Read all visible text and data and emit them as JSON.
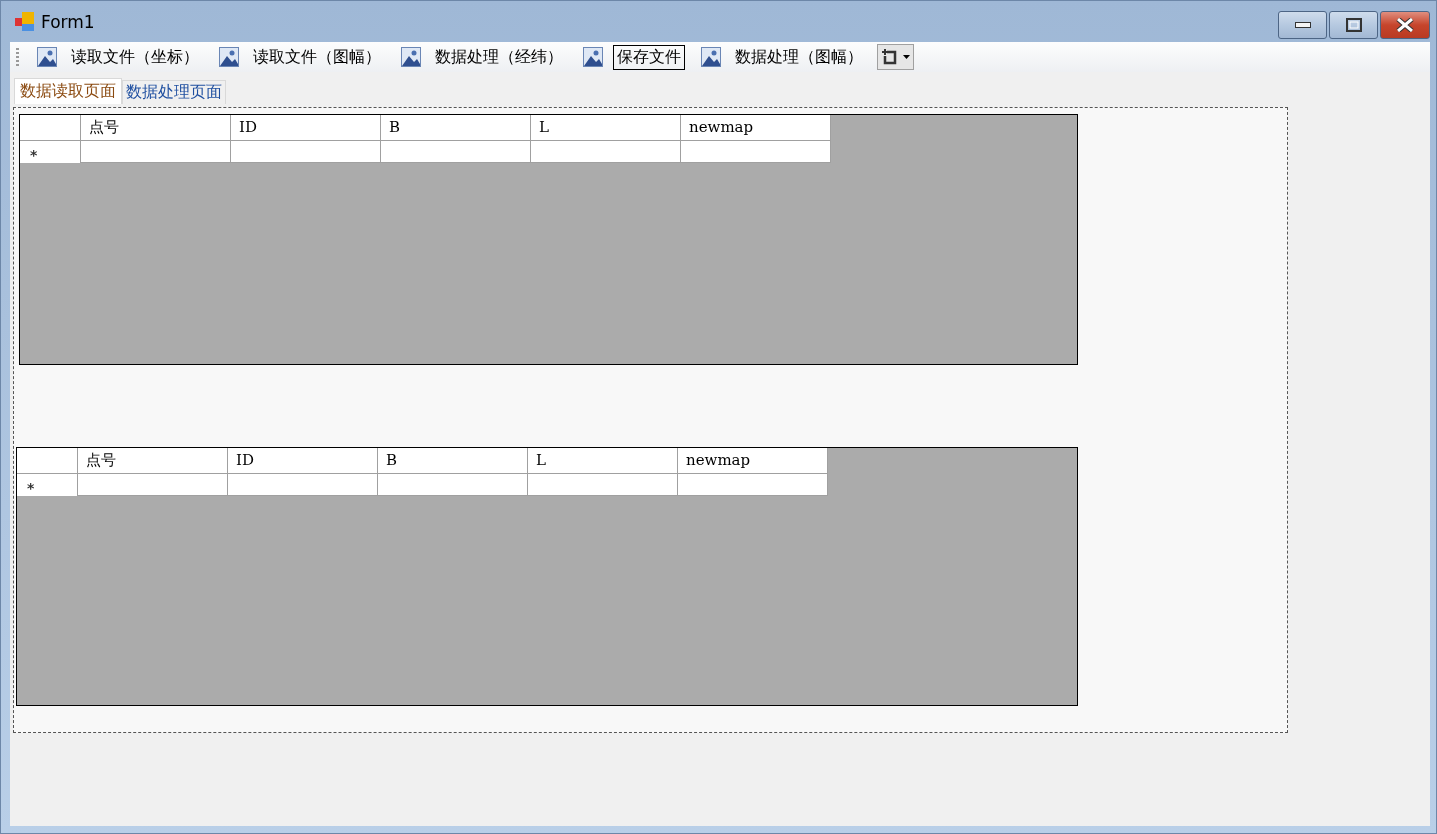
{
  "window": {
    "title": "Form1"
  },
  "toolbar": [
    {
      "kind": "image-text",
      "label": "读取文件（坐标）",
      "focused": false
    },
    {
      "kind": "image-text",
      "label": "读取文件（图幅）",
      "focused": false
    },
    {
      "kind": "image-text",
      "label": "数据处理（经纬）",
      "focused": false
    },
    {
      "kind": "image-text",
      "label": "保存文件",
      "focused": true
    },
    {
      "kind": "image-text",
      "label": "数据处理（图幅）",
      "focused": false
    },
    {
      "kind": "dropdown"
    }
  ],
  "tabs": [
    {
      "label": "数据读取页面",
      "selected": true
    },
    {
      "label": "数据处理页面",
      "selected": false
    }
  ],
  "grids": [
    {
      "columns": [
        "点号",
        "ID",
        "B",
        "L",
        "newmap"
      ],
      "new_row_marker": "*"
    },
    {
      "columns": [
        "点号",
        "ID",
        "B",
        "L",
        "newmap"
      ],
      "new_row_marker": "*"
    }
  ]
}
